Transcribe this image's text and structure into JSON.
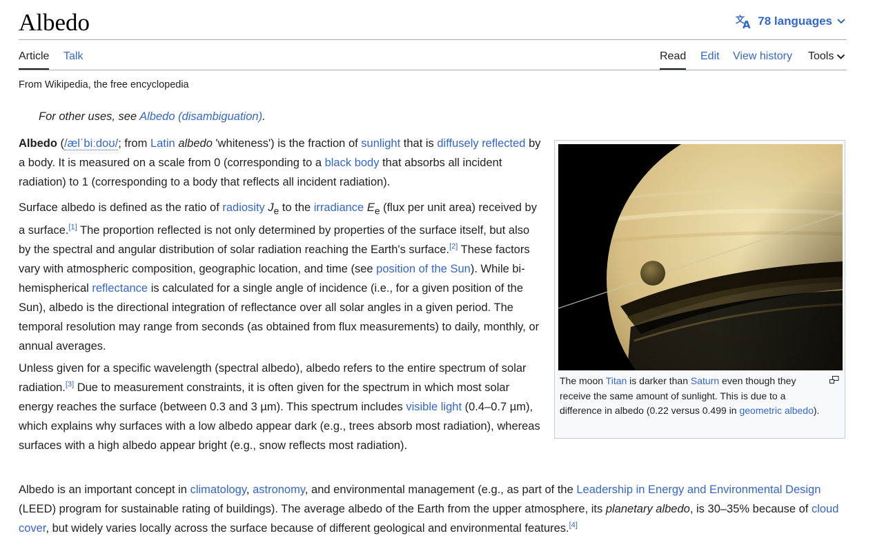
{
  "page": {
    "title": "Albedo",
    "languages": "78 languages",
    "tagline": "From Wikipedia, the free encyclopedia"
  },
  "tabs": {
    "article": "Article",
    "talk": "Talk",
    "read": "Read",
    "edit": "Edit",
    "history": "View history",
    "tools": "Tools"
  },
  "hatnote": {
    "prefix": "For other uses, see ",
    "link": "Albedo (disambiguation)",
    "suffix": "."
  },
  "p1": {
    "bold": "Albedo",
    "t1": " (",
    "ipa": "/ælˈbiːdoʊ/",
    "t2": "; from ",
    "l1": "Latin",
    "t3": " ",
    "i1": "albedo",
    "t4": " 'whiteness') is the fraction of ",
    "l2": "sunlight",
    "t5": " that is ",
    "l3": "diffusely reflected",
    "t6": " by a body. It is measured on a scale from 0 (corresponding to a ",
    "l4": "black body",
    "t7": " that absorbs all incident radiation) to 1 (corresponding to a body that reflects all incident radiation)."
  },
  "p2": {
    "t1": "Surface albedo is defined as the ratio of ",
    "l1": "radiosity",
    "t2": " ",
    "v1": "J",
    "s1": "e",
    "t3": " to the ",
    "l2": "irradiance",
    "t4": " ",
    "v2": "E",
    "s2": "e",
    "t5": " (flux per unit area) received by a surface.",
    "r1": "[1]",
    "t6": " The proportion reflected is not only determined by properties of the surface itself, but also by the spectral and angular distribution of solar radiation reaching the Earth's surface.",
    "r2": "[2]",
    "t7": " These factors vary with atmospheric composition, geographic location, and time (see ",
    "l3": "position of the Sun",
    "t8": "). While bi-hemispherical ",
    "l4": "reflectance",
    "t9": " is calculated for a single angle of incidence (i.e., for a given position of the Sun), albedo is the directional integration of reflectance over all solar angles in a given period. The temporal resolution may range from seconds (as obtained from flux measurements) to daily, monthly, or annual averages."
  },
  "p3": {
    "t1": "Unless given for a specific wavelength (spectral albedo), albedo refers to the entire spectrum of solar radiation.",
    "r1": "[3]",
    "t2": " Due to measurement constraints, it is often given for the spectrum in which most solar energy reaches the surface (between 0.3 and 3 µm). This spectrum includes ",
    "l1": "visible light",
    "t3": " (0.4–0.7 µm), which explains why surfaces with a low albedo appear dark (e.g., trees absorb most radiation), whereas surfaces with a high albedo appear bright (e.g., snow reflects most radiation)."
  },
  "p4": {
    "t1": "Albedo is an important concept in ",
    "l1": "climatology",
    "t2": ", ",
    "l2": "astronomy",
    "t3": ", and environmental management (e.g., as part of the ",
    "l3": "Leadership in Energy and Environmental Design",
    "t4": " (LEED) program for sustainable rating of buildings). The average albedo of the Earth from the upper atmosphere, its ",
    "i1": "planetary albedo",
    "t5": ", is 30–35% because of ",
    "l4": "cloud cover",
    "t6": ", but widely varies locally across the surface because of different geological and environmental features.",
    "r1": "[4]"
  },
  "infobox": {
    "t1": "The moon ",
    "l1": "Titan",
    "t2": " is darker than ",
    "l2": "Saturn",
    "t3": " even though they receive the same amount of sunlight. This is due to a difference in albedo (0.22 versus 0.499 in ",
    "l3": "geometric albedo",
    "t4": ")."
  },
  "colors": {
    "link": "#3366cc",
    "text": "#202122",
    "border": "#a2a9b1"
  }
}
